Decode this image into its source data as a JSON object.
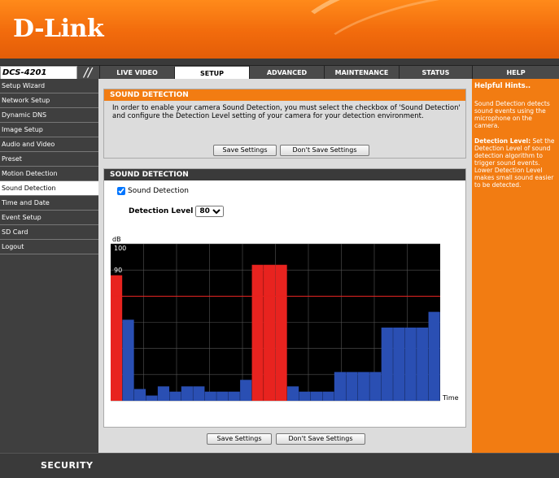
{
  "brand": {
    "logo_text": "D-Link"
  },
  "navbar": {
    "model": "DCS-4201",
    "tabs": [
      {
        "label": "LIVE VIDEO"
      },
      {
        "label": "SETUP"
      },
      {
        "label": "ADVANCED"
      },
      {
        "label": "MAINTENANCE"
      },
      {
        "label": "STATUS"
      },
      {
        "label": "HELP"
      }
    ],
    "active_tab": "SETUP"
  },
  "sidebar": {
    "items": [
      {
        "label": "Setup Wizard"
      },
      {
        "label": "Network Setup"
      },
      {
        "label": "Dynamic DNS"
      },
      {
        "label": "Image Setup"
      },
      {
        "label": "Audio and Video"
      },
      {
        "label": "Preset"
      },
      {
        "label": "Motion Detection"
      },
      {
        "label": "Sound Detection"
      },
      {
        "label": "Time and Date"
      },
      {
        "label": "Event Setup"
      },
      {
        "label": "SD Card"
      },
      {
        "label": "Logout"
      }
    ],
    "active_item": "Sound Detection"
  },
  "intro": {
    "title": "SOUND DETECTION",
    "text": "In order to enable your camera Sound Detection, you must select the checkbox of 'Sound Detection' and configure the Detection Level setting of your camera for your detection environment.",
    "save_label": "Save Settings",
    "dont_save_label": "Don't Save Settings"
  },
  "panel": {
    "title": "SOUND DETECTION",
    "checkbox_label": "Sound Detection",
    "checkbox_checked": true,
    "level_label": "Detection Level",
    "level_value": "80"
  },
  "bottom_buttons": {
    "save_label": "Save Settings",
    "dont_save_label": "Don't Save Settings"
  },
  "hints": {
    "title": "Helpful Hints..",
    "para1": "Sound Detection detects sound events using the microphone on the camera.",
    "para2_bold": "Detection Level:",
    "para2": " Set the Detection Level of sound detection algorithm to trigger sound events. Lower Detection Level makes small sound easier to be detected."
  },
  "footer": {
    "label": "SECURITY"
  },
  "chart_data": {
    "type": "bar",
    "ylabel": "dB",
    "xlabel": "Time",
    "ylim": [
      40,
      100
    ],
    "yticks": [
      40,
      50,
      60,
      70,
      80,
      90,
      100
    ],
    "threshold": 80,
    "grid": true,
    "colors": {
      "above": "#e8231f",
      "below": "#2a4fb3",
      "threshold": "#e8231f",
      "background": "#000000",
      "grid": "#555555"
    },
    "values": [
      88,
      71,
      44.5,
      42,
      45.5,
      43.5,
      45.5,
      45.5,
      43.5,
      43.5,
      43.5,
      48,
      92,
      92,
      92,
      45.5,
      43.5,
      43.5,
      43.5,
      51,
      51,
      51,
      51,
      68,
      68,
      68,
      68,
      74
    ]
  }
}
